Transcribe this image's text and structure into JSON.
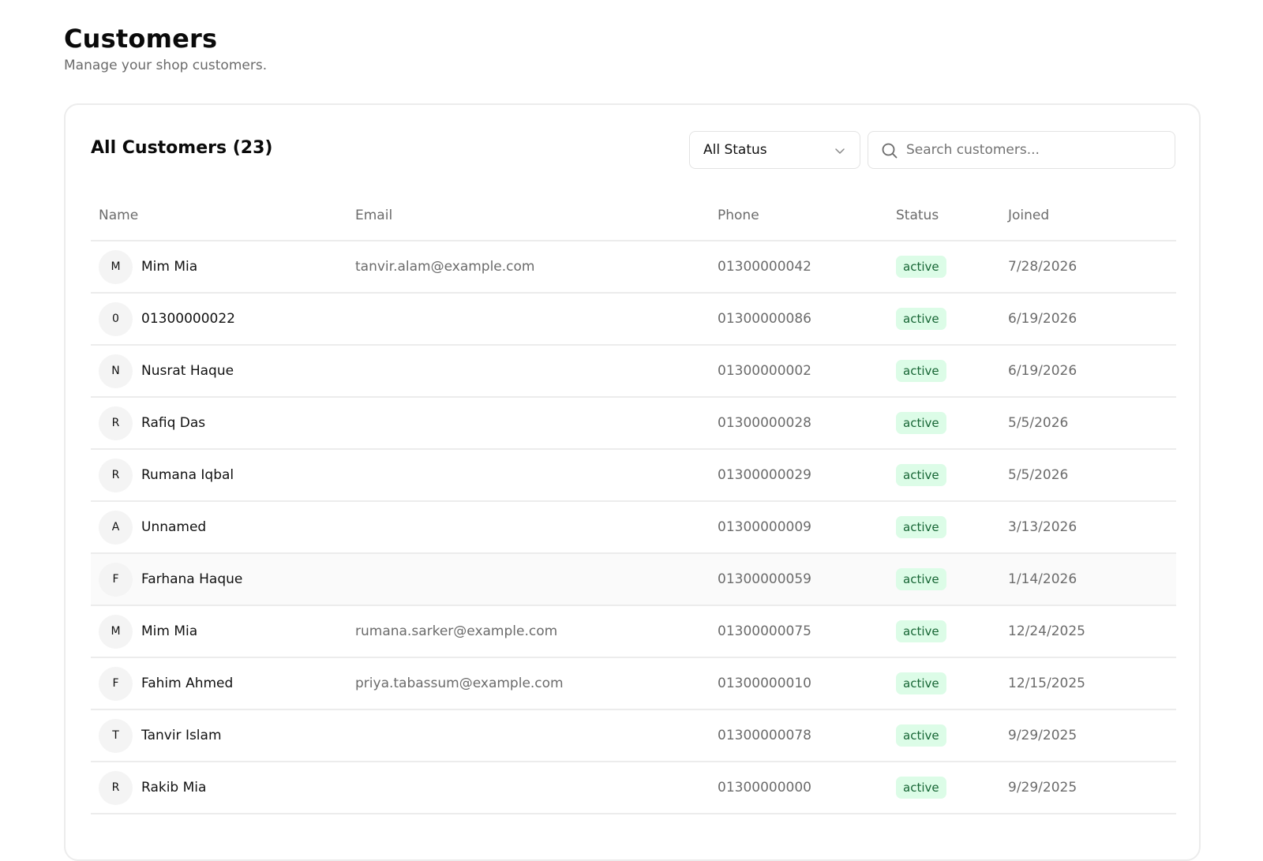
{
  "header": {
    "title": "Customers",
    "subtitle": "Manage your shop customers."
  },
  "card": {
    "title": "All Customers (23)",
    "status_filter": {
      "selected": "All Status"
    },
    "search": {
      "placeholder": "Search customers...",
      "value": ""
    }
  },
  "table": {
    "columns": [
      "Name",
      "Email",
      "Phone",
      "Status",
      "Joined"
    ],
    "rows": [
      {
        "initial": "M",
        "name": "Mim Mia",
        "email": "tanvir.alam@example.com",
        "phone": "01300000042",
        "status": "active",
        "joined": "7/28/2026"
      },
      {
        "initial": "0",
        "name": "01300000022",
        "email": "",
        "phone": "01300000086",
        "status": "active",
        "joined": "6/19/2026"
      },
      {
        "initial": "N",
        "name": "Nusrat Haque",
        "email": "",
        "phone": "01300000002",
        "status": "active",
        "joined": "6/19/2026"
      },
      {
        "initial": "R",
        "name": "Rafiq Das",
        "email": "",
        "phone": "01300000028",
        "status": "active",
        "joined": "5/5/2026"
      },
      {
        "initial": "R",
        "name": "Rumana Iqbal",
        "email": "",
        "phone": "01300000029",
        "status": "active",
        "joined": "5/5/2026"
      },
      {
        "initial": "A",
        "name": "Unnamed",
        "email": "",
        "phone": "01300000009",
        "status": "active",
        "joined": "3/13/2026"
      },
      {
        "initial": "F",
        "name": "Farhana Haque",
        "email": "",
        "phone": "01300000059",
        "status": "active",
        "joined": "1/14/2026"
      },
      {
        "initial": "M",
        "name": "Mim Mia",
        "email": "rumana.sarker@example.com",
        "phone": "01300000075",
        "status": "active",
        "joined": "12/24/2025"
      },
      {
        "initial": "F",
        "name": "Fahim Ahmed",
        "email": "priya.tabassum@example.com",
        "phone": "01300000010",
        "status": "active",
        "joined": "12/15/2025"
      },
      {
        "initial": "T",
        "name": "Tanvir Islam",
        "email": "",
        "phone": "01300000078",
        "status": "active",
        "joined": "9/29/2025"
      },
      {
        "initial": "R",
        "name": "Rakib Mia",
        "email": "",
        "phone": "01300000000",
        "status": "active",
        "joined": "9/29/2025"
      }
    ]
  },
  "colors": {
    "badge_bg": "#dcfce7",
    "badge_text": "#166534",
    "border": "#ececec",
    "muted_text": "#6b6b6b"
  },
  "icons": {
    "search": "search-icon",
    "dropdown": "chevron-down-icon"
  }
}
